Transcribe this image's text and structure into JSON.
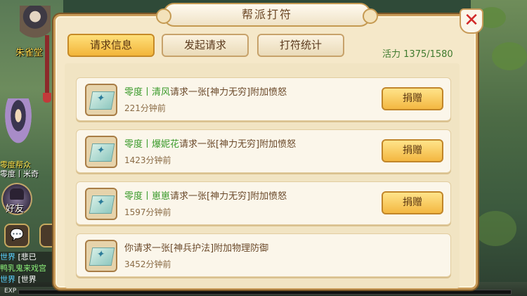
{
  "scene": {
    "player_name": "朱雀堂",
    "guild_label": "零度帮众",
    "npc_name": "零度丨米奇",
    "friend_label": "好友",
    "chat_icon": "chat-bubble-icon",
    "chat_lines": [
      {
        "tag": "世界",
        "text": "[悲已"
      },
      {
        "tag": "",
        "text": "鸭乳鬼来戏宫"
      },
      {
        "tag": "世界",
        "text": "[世界"
      }
    ],
    "exp_label": "EXP",
    "exp_progress": 0.0
  },
  "dialog": {
    "title": "帮派打符",
    "close_icon": "close-x-icon",
    "tabs": [
      {
        "label": "请求信息",
        "active": true
      },
      {
        "label": "发起请求",
        "active": false
      },
      {
        "label": "打符统计",
        "active": false
      }
    ],
    "activity_label": "活力",
    "activity_value": "1375/1580",
    "requests": [
      {
        "prefix": "零度丨",
        "who": "清风",
        "text": "请求一张[神力无穷]附加愤怒",
        "time": "221分钟前",
        "button": "捐赠"
      },
      {
        "prefix": "零度丨",
        "who": "爆妮花",
        "text": "请求一张[神力无穷]附加愤怒",
        "time": "1423分钟前",
        "button": "捐赠"
      },
      {
        "prefix": "零度丨",
        "who": "崽崽",
        "text": "请求一张[神力无穷]附加愤怒",
        "time": "1597分钟前",
        "button": "捐赠"
      },
      {
        "prefix": "",
        "who": "",
        "text": "你请求一张[神兵护法]附加物理防御",
        "time": "3452分钟前",
        "button": ""
      }
    ]
  },
  "colors": {
    "panel_bg": "#f5e8c9",
    "accent_gold": "#f2b53a",
    "name_green": "#3a9a2a",
    "close_red": "#d12a2a"
  }
}
